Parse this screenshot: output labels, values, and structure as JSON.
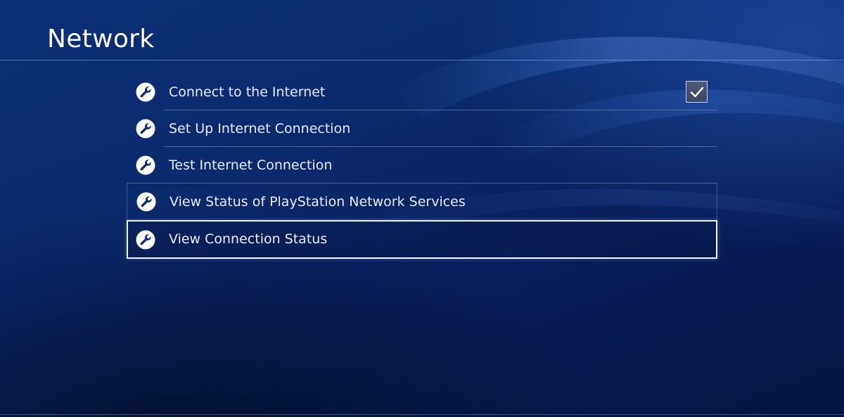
{
  "header": {
    "title": "Network"
  },
  "menu": {
    "items": [
      {
        "label": "Connect to the Internet",
        "icon": "wrench-icon",
        "checked": true
      },
      {
        "label": "Set Up Internet Connection",
        "icon": "wrench-icon"
      },
      {
        "label": "Test Internet Connection",
        "icon": "wrench-icon"
      },
      {
        "label": "View Status of PlayStation Network Services",
        "icon": "wrench-icon"
      },
      {
        "label": "View Connection Status",
        "icon": "wrench-icon",
        "selected": true
      }
    ]
  },
  "colors": {
    "background": "#0a2a6e",
    "text": "#ffffff",
    "selection_border": "#f2f5fc",
    "divider": "#96aad7"
  }
}
